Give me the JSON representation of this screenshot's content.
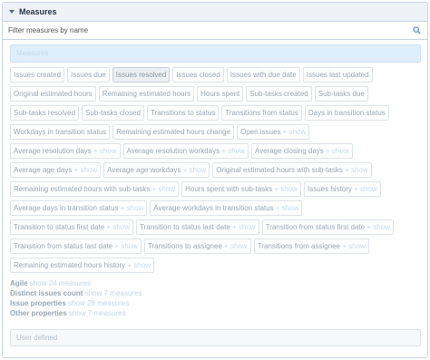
{
  "panel": {
    "title": "Measures",
    "filter_placeholder": "Filter measures by name",
    "section_label": "Measures"
  },
  "chips": [
    {
      "label": "Issues created",
      "show": ""
    },
    {
      "label": "Issues due",
      "show": ""
    },
    {
      "label": "Issues resolved",
      "show": "",
      "selected": true
    },
    {
      "label": "Issues closed",
      "show": ""
    },
    {
      "label": "Issues with due date",
      "show": ""
    },
    {
      "label": "Issues last updated",
      "show": ""
    },
    {
      "label": "Original estimated hours",
      "show": ""
    },
    {
      "label": "Remaining estimated hours",
      "show": ""
    },
    {
      "label": "Hours spent",
      "show": ""
    },
    {
      "label": "Sub-tasks created",
      "show": ""
    },
    {
      "label": "Sub-tasks due",
      "show": ""
    },
    {
      "label": "Sub-tasks resolved",
      "show": ""
    },
    {
      "label": "Sub-tasks closed",
      "show": ""
    },
    {
      "label": "Transitions to status",
      "show": ""
    },
    {
      "label": "Transitions from status",
      "show": ""
    },
    {
      "label": "Days in transition status",
      "show": ""
    },
    {
      "label": "Workdays in transition status",
      "show": ""
    },
    {
      "label": "Remaining estimated hours change",
      "show": ""
    },
    {
      "label": "Open issues",
      "show": "+ show"
    },
    {
      "label": "Average resolution days",
      "show": "+ show"
    },
    {
      "label": "Average resolution workdays",
      "show": "+ show"
    },
    {
      "label": "Average closing days",
      "show": "+ show"
    },
    {
      "label": "Average age days",
      "show": "+ show"
    },
    {
      "label": "Average age workdays",
      "show": "+ show"
    },
    {
      "label": "Original estimated hours with sub-tasks",
      "show": "+ show"
    },
    {
      "label": "Remaining estimated hours with sub-tasks",
      "show": "+ show"
    },
    {
      "label": "Hours spent with sub-tasks",
      "show": "+ show"
    },
    {
      "label": "Issues history",
      "show": "+ show"
    },
    {
      "label": "Average days in transition status",
      "show": "+ show"
    },
    {
      "label": "Average workdays in transition status",
      "show": "+ show"
    },
    {
      "label": "Transition to status first date",
      "show": "+ show"
    },
    {
      "label": "Transition to status last date",
      "show": "+ show"
    },
    {
      "label": "Transition from status first date",
      "show": "+ show"
    },
    {
      "label": "Transition from status last date",
      "show": "+ show"
    },
    {
      "label": "Transitions to assignee",
      "show": "+ show"
    },
    {
      "label": "Transitions from assignee",
      "show": "+ show"
    },
    {
      "label": "Remaining estimated hours history",
      "show": "+ show"
    }
  ],
  "categories": [
    {
      "name": "Agile",
      "link": "show 24 measures"
    },
    {
      "name": "Distinct issues count",
      "link": "show 7 measures"
    },
    {
      "name": "Issue properties",
      "link": "show 28 measures"
    },
    {
      "name": "Other properties",
      "link": "show 7 measures"
    }
  ],
  "user_defined_label": "User defined"
}
